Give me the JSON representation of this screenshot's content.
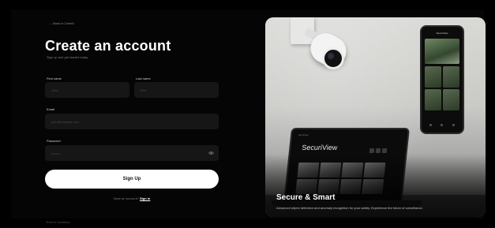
{
  "back_link": "← Back to CamAI",
  "title": "Create an account",
  "subtitle": "Sign up and get started today",
  "form": {
    "first_name": {
      "label": "First name",
      "placeholder": "John"
    },
    "last_name": {
      "label": "Last name",
      "placeholder": "Doe"
    },
    "email": {
      "label": "Email",
      "placeholder": "john@example.com"
    },
    "password": {
      "label": "Password",
      "placeholder": "••••••••"
    },
    "signup_button": "Sign Up",
    "have_account": "Have an account?",
    "signin_link": "Sign in"
  },
  "terms": "Terms & Conditions",
  "hero": {
    "phone_title": "SecuriView",
    "laptop_title": "SecuriView",
    "laptop_top": "SecuriView",
    "heading": "Secure & Smart",
    "description": "Advanced object detection and anomaly recognition for your safety. Experience the future of surveillance."
  }
}
